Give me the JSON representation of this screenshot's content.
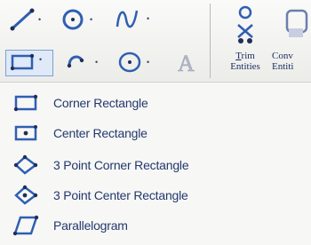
{
  "toolbar": {
    "trim": {
      "label_line1": "Trim",
      "label_line1_mnemonic": "T",
      "label_line2": "Entities"
    },
    "convert": {
      "label_line1": "Conv",
      "label_line2": "Entiti"
    },
    "icons": [
      "line-icon",
      "circle-icon",
      "spline-icon",
      "rectangle-icon",
      "slot-icon",
      "polygon-icon",
      "text-icon"
    ]
  },
  "menu": {
    "items": [
      {
        "label": "Corner Rectangle",
        "icon": "corner-rectangle-icon"
      },
      {
        "label": "Center Rectangle",
        "icon": "center-rectangle-icon"
      },
      {
        "label": "3 Point Corner Rectangle",
        "icon": "3-point-corner-rectangle-icon"
      },
      {
        "label": "3 Point Center Rectangle",
        "icon": "3-point-center-rectangle-icon"
      },
      {
        "label": "Parallelogram",
        "icon": "parallelogram-icon"
      }
    ]
  },
  "colors": {
    "icon_blue": "#2f5fb3",
    "icon_dark": "#1f2e5a",
    "text": "#23386e"
  }
}
